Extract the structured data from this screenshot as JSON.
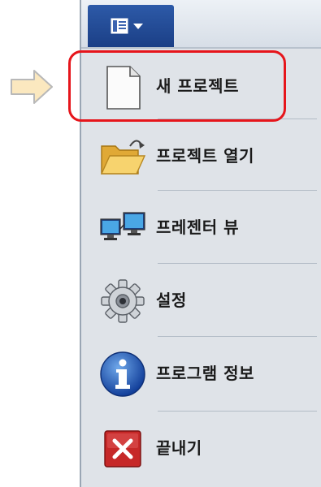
{
  "menu": {
    "tab_icon": "app-menu-icon",
    "items": [
      {
        "label": "새 프로젝트",
        "icon": "new-document-icon"
      },
      {
        "label": "프로젝트 열기",
        "icon": "open-folder-icon"
      },
      {
        "label": "프레젠터 뷰",
        "icon": "presenter-view-icon"
      },
      {
        "label": "설정",
        "icon": "gear-icon"
      },
      {
        "label": "프로그램 정보",
        "icon": "info-icon"
      },
      {
        "label": "끝내기",
        "icon": "close-icon"
      }
    ]
  },
  "colors": {
    "highlight": "#e6151b",
    "tab": "#1b3f86",
    "menu_bg": "#dfe3e8"
  }
}
